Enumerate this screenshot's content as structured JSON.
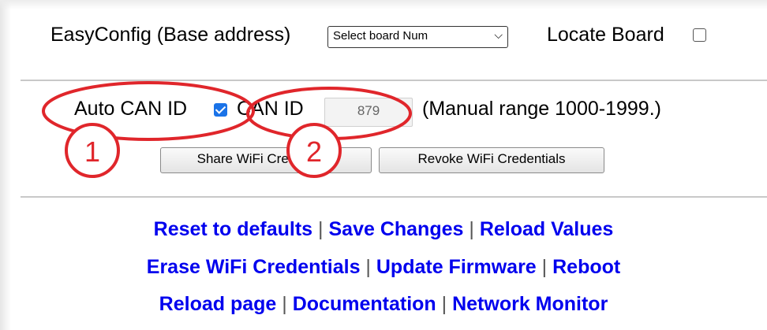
{
  "easyconfig": {
    "label": "EasyConfig (Base address)",
    "board_select_value": "Select board Num",
    "locate_label": "Locate Board",
    "locate_checked": false
  },
  "can": {
    "auto_label": "Auto CAN ID",
    "auto_checked": true,
    "id_label": "CAN ID",
    "id_value": "879",
    "range_note": "(Manual range 1000-1999.)"
  },
  "wifi": {
    "share_label": "Share WiFi Credentials",
    "revoke_label": "Revoke WiFi Credentials"
  },
  "links": {
    "row1": [
      "Reset to defaults",
      "Save Changes",
      "Reload Values"
    ],
    "row2": [
      "Erase WiFi Credentials",
      "Update Firmware",
      "Reboot"
    ],
    "row3": [
      "Reload page",
      "Documentation",
      "Network Monitor"
    ],
    "separator": "|"
  },
  "annotations": {
    "badge1": "1",
    "badge2": "2",
    "color": "#e0262b"
  }
}
